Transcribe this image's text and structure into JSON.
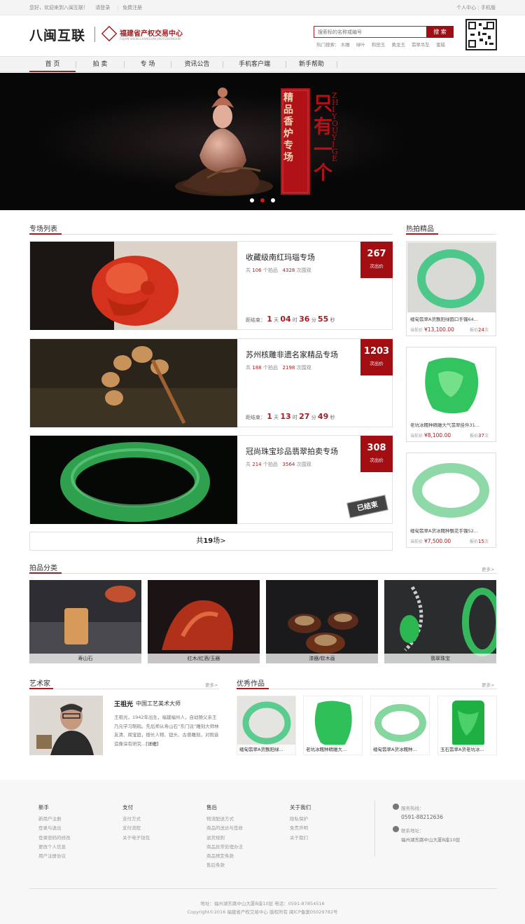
{
  "topbar": {
    "welcome": "您好，欢迎来到八闽互联！",
    "login": "请登录",
    "register": "免费注册",
    "personal": "个人中心",
    "mobile": "手机版"
  },
  "header": {
    "logo": "八闽互联",
    "org_name": "福建省产权交易中心",
    "org_sub": "FUJIAN SHENGCHANQUAN JIAOYIZHONGXIN",
    "search_placeholder": "搜索标的名称或编号",
    "search_button": "搜 索",
    "hot_label": "热门搜索：",
    "hot_terms": [
      "木雕",
      "绿叶",
      "和田玉",
      "黄龙玉",
      "翡翠吊坠",
      "蜜蜡"
    ]
  },
  "nav": [
    "首 页",
    "拍 卖",
    "专 场",
    "资讯公告",
    "手机客户端",
    "新手帮助"
  ],
  "banner": {
    "vertical_main": "只有一个",
    "vertical_sub": "精品香炉专场",
    "vertical_en": "ZHIYOUYIGE"
  },
  "specials": {
    "title": "专场列表",
    "items": [
      {
        "name": "收藏级南红玛瑙专场",
        "lots_pre": "共",
        "lots": "106",
        "lots_unit": "个拍品",
        "views": "4328",
        "views_unit": "次围观",
        "cd_label": "距结束：",
        "d": "1",
        "h": "04",
        "m": "36",
        "s": "55",
        "bids": "267",
        "bids_label": "次出价"
      },
      {
        "name": "苏州核雕非遗名家精品专场",
        "lots_pre": "共",
        "lots": "188",
        "lots_unit": "个拍品",
        "views": "2198",
        "views_unit": "次围观",
        "cd_label": "距结束：",
        "d": "1",
        "h": "13",
        "m": "27",
        "s": "49",
        "bids": "1203",
        "bids_label": "次出价"
      },
      {
        "name": "冠尚珠宝珍品翡翠拍卖专场",
        "lots_pre": "共",
        "lots": "214",
        "lots_unit": "个拍品",
        "views": "3564",
        "views_unit": "次围观",
        "ended": "已结束",
        "bids": "308",
        "bids_label": "次出价"
      }
    ],
    "total_pre": "共",
    "total_num": "19",
    "total_post": "场>"
  },
  "units": {
    "day": "天",
    "hour": "时",
    "min": "分",
    "sec": "秒"
  },
  "hot": {
    "title": "热拍精品",
    "price_label": "当前价",
    "bid_label": "报价",
    "bid_unit": "次",
    "items": [
      {
        "name": "缅甸翡翠A货飘阳绿圆口手镯64...",
        "price": "¥13,100.00",
        "bids": "24"
      },
      {
        "name": "老坑冰糯种精雕大气翡翠挂件31...",
        "price": "¥8,100.00",
        "bids": "37"
      },
      {
        "name": "缅甸翡翠A货冰糯种飘花手镯52...",
        "price": "¥7,500.00",
        "bids": "15"
      }
    ]
  },
  "categories": {
    "title": "拍品分类",
    "more": "更多>",
    "items": [
      "寿山石",
      "红木/红酒/玉器",
      "漆器/软木画",
      "翡翠珠宝"
    ]
  },
  "artist": {
    "title": "艺术家",
    "more": "更多>",
    "name": "王祖光",
    "rank": "中国工艺美术大师",
    "bio": "王祖光，1942年出生，福建福州人，自幼随父亲王乃元学习制砚。先后师从寿山石“东门派”雕刻大师林友清、周宝庭，擅长人物、钮头、古兽雕刻，对观音造像深有研究...",
    "detail": "[详细]"
  },
  "works": {
    "title": "优秀作品",
    "more": "更多>",
    "items": [
      "缅甸翡翠A货飘阳绿...",
      "老坑冰糯种精雕大...",
      "缅甸翡翠A货冰糯种...",
      "玉石翡翠A货老坑冰..."
    ]
  },
  "footer": {
    "cols": [
      {
        "h": "新手",
        "items": [
          "新用户注册",
          "登录与退出",
          "登录密码的修改",
          "更改个人信息",
          "用户注册协议"
        ]
      },
      {
        "h": "支付",
        "items": [
          "支付方式",
          "支付流程",
          "关于电子钱包"
        ]
      },
      {
        "h": "售后",
        "items": [
          "物流配送方式",
          "商品的送达与签收",
          "退货规则",
          "商品异常处理办法",
          "商品预定条款",
          "售后条款"
        ]
      },
      {
        "h": "关于我们",
        "items": [
          "隐私保护",
          "免责声明",
          "关于我们"
        ]
      }
    ],
    "hotline_label": "服务热线：",
    "hotline": "0591-88212636",
    "address_label": "联系地址：",
    "address": "福州湖东路中山大厦B座10层",
    "bottom1": "地址：福州湖东路中山大厦B座10层    电话：0591-87854516",
    "bottom2": "Copyright©2016  福建省产权交易中心 版权所有   闽ICP备案05029782号"
  },
  "colors": {
    "brand": "#a31f24",
    "bid_box": "#a30e13"
  }
}
